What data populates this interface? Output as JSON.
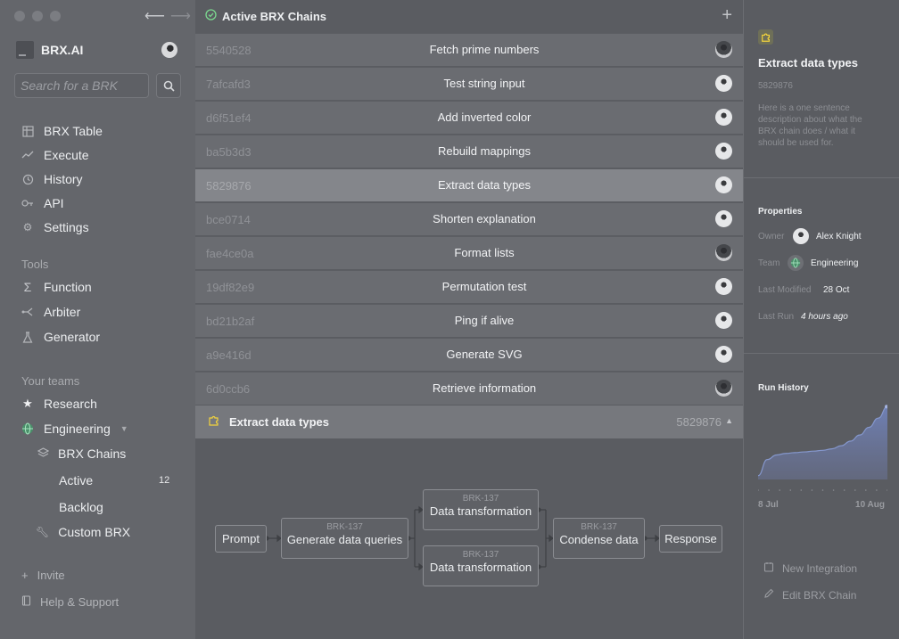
{
  "window": {
    "nav_back": "⟵",
    "nav_forward": "⟶"
  },
  "sidebar": {
    "brand": "BRX.AI",
    "search_placeholder": "Search for a BRK",
    "nav": [
      {
        "label": "BRX Table",
        "icon": "table-icon"
      },
      {
        "label": "Execute",
        "icon": "trend-icon"
      },
      {
        "label": "History",
        "icon": "history-icon"
      },
      {
        "label": "API",
        "icon": "key-icon"
      },
      {
        "label": "Settings",
        "icon": "gear-icon"
      }
    ],
    "tools_label": "Tools",
    "tools": [
      {
        "label": "Function",
        "icon": "sigma-icon"
      },
      {
        "label": "Arbiter",
        "icon": "branch-icon"
      },
      {
        "label": "Generator",
        "icon": "flask-icon"
      }
    ],
    "teams_label": "Your teams",
    "teams": [
      {
        "label": "Research",
        "icon": "star-icon"
      },
      {
        "label": "Engineering",
        "icon": "globe-icon"
      }
    ],
    "engineering_children": {
      "brx_chains": "BRX Chains",
      "active": "Active",
      "active_count": "12",
      "backlog": "Backlog",
      "custom_brx": "Custom BRX"
    },
    "invite": "Invite",
    "help": "Help & Support"
  },
  "main": {
    "title": "Active BRX Chains",
    "plus": "+",
    "rows": [
      {
        "id": "5540528",
        "name": "Fetch prime numbers",
        "avatar": "dark"
      },
      {
        "id": "7afcafd3",
        "name": "Test string input",
        "avatar": "light"
      },
      {
        "id": "d6f51ef4",
        "name": "Add inverted color",
        "avatar": "light"
      },
      {
        "id": "ba5b3d3",
        "name": "Rebuild mappings",
        "avatar": "light"
      },
      {
        "id": "5829876",
        "name": "Extract data types",
        "avatar": "light"
      },
      {
        "id": "bce0714",
        "name": "Shorten explanation",
        "avatar": "light"
      },
      {
        "id": "fae4ce0a",
        "name": "Format lists",
        "avatar": "dark"
      },
      {
        "id": "19df82e9",
        "name": "Permutation test",
        "avatar": "light"
      },
      {
        "id": "bd21b2af",
        "name": "Ping if alive",
        "avatar": "light"
      },
      {
        "id": "a9e416d",
        "name": "Generate SVG",
        "avatar": "light"
      },
      {
        "id": "6d0ccb6",
        "name": "Retrieve information",
        "avatar": "dark"
      }
    ],
    "selected_index": 4,
    "detail": {
      "title": "Extract data types",
      "id": "5829876",
      "caret": "▲"
    },
    "flow": {
      "prompt": "Prompt",
      "generate_tag": "BRK-137",
      "generate": "Generate data queries",
      "transform_top_tag": "BRK-137",
      "transform_top": "Data transformation",
      "transform_bottom_tag": "BRK-137",
      "transform_bottom": "Data transformation",
      "condense_tag": "BRK-137",
      "condense": "Condense data",
      "response": "Response"
    }
  },
  "panel": {
    "title": "Extract data types",
    "id": "5829876",
    "description": "Here is a one sentence description about what the BRX chain does / what it should be used for.",
    "properties_heading": "Properties",
    "owner_key": "Owner",
    "owner": "Alex Knight",
    "team_key": "Team",
    "team": "Engineering",
    "modified_key": "Last Modified",
    "modified": "28 Oct",
    "run_key": "Last Run",
    "run": "4 hours ago",
    "history_heading": "Run History",
    "history_start": "8 Jul",
    "history_end": "10 Aug",
    "new_integration": "New Integration",
    "edit_chain": "Edit BRX Chain",
    "accent": "#7bd88f"
  },
  "chart_data": {
    "type": "area",
    "x": [
      0,
      1,
      2,
      3,
      4,
      5,
      6,
      7,
      8,
      9,
      10,
      11,
      12,
      13,
      14
    ],
    "values": [
      5,
      26,
      32,
      34,
      35,
      36,
      37,
      38,
      40,
      44,
      50,
      58,
      68,
      80,
      95
    ],
    "xlabel": "",
    "ylabel": "",
    "xticks": [
      "8 Jul",
      "10 Aug"
    ],
    "ylim": [
      0,
      100
    ]
  }
}
